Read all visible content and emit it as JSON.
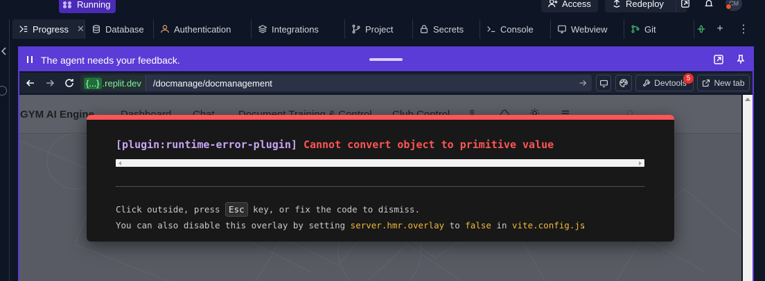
{
  "header": {
    "status_label": "Running",
    "access_label": "Access",
    "redeploy_label": "Redeploy",
    "avatar_initials": "CM"
  },
  "tabs": [
    {
      "label": "Progress",
      "icon": "progress-icon",
      "active": true
    },
    {
      "label": "Database",
      "icon": "database-icon"
    },
    {
      "label": "Authentication",
      "icon": "user-icon"
    },
    {
      "label": "Integrations",
      "icon": "layers-icon"
    },
    {
      "label": "Project",
      "icon": "branch-icon"
    },
    {
      "label": "Secrets",
      "icon": "lock-icon"
    },
    {
      "label": "Console",
      "icon": "terminal-icon"
    },
    {
      "label": "Webview",
      "icon": "monitor-icon"
    },
    {
      "label": "Git",
      "icon": "git-icon"
    }
  ],
  "feedback": {
    "message": "The agent needs your feedback."
  },
  "urlbar": {
    "domain_braces": "{...}",
    "domain_suffix": ".replit.dev",
    "path": "/docmanage/docmanagement",
    "devtools_label": "Devtools",
    "devtools_badge": "5",
    "new_tab_label": "New tab"
  },
  "site": {
    "brand": "GYM AI Engine",
    "nav": [
      "Dashboard",
      "Chat",
      "Document Training & Control",
      "Club Control"
    ]
  },
  "error_overlay": {
    "plugin": "[plugin:runtime-error-plugin]",
    "message": "Cannot convert object to primitive value",
    "tip1_before": "Click outside, press",
    "tip1_key": "Esc",
    "tip1_after": "key, or fix the code to dismiss.",
    "tip2_before": "You can also disable this overlay by setting",
    "tip2_code1": "server.hmr.overlay",
    "tip2_mid1": "to",
    "tip2_code2": "false",
    "tip2_mid2": "in",
    "tip2_code3": "vite.config.js",
    "tip2_end": "."
  },
  "colors": {
    "accent": "#5b3cd6",
    "error": "#ff5555",
    "running": "#4b2bb5"
  }
}
